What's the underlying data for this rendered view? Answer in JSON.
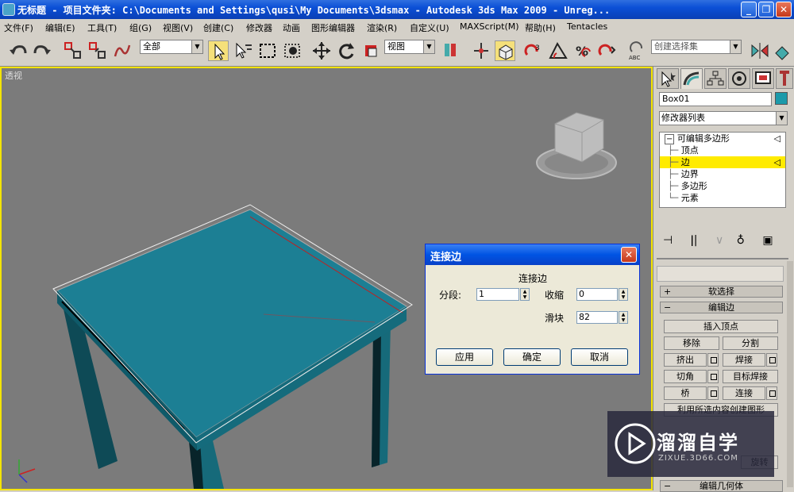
{
  "title": {
    "app_title": "无标题   - 项目文件夹: C:\\Documents and Settings\\qusi\\My Documents\\3dsmax   - Autodesk 3ds Max  2009  - Unreg..."
  },
  "menu": [
    "文件(F)",
    "编辑(E)",
    "工具(T)",
    "组(G)",
    "视图(V)",
    "创建(C)",
    "修改器",
    "动画",
    "图形编辑器",
    "渲染(R)",
    "自定义(U)",
    "MAXScript(M)",
    "帮助(H)",
    "Tentacles"
  ],
  "toolbar": {
    "selection_filter": "全部",
    "ref_coord": "视图",
    "named_selection": "创建选择集"
  },
  "viewport": {
    "label": "透视"
  },
  "dialog": {
    "title": "连接边",
    "group_label": "连接边",
    "segments_label": "分段:",
    "segments_value": "1",
    "pinch_label": "收缩",
    "pinch_value": "0",
    "slide_label": "滑块",
    "slide_value": "82",
    "apply": "应用",
    "ok": "确定",
    "cancel": "取消"
  },
  "panel": {
    "object_name": "Box01",
    "object_color": "#1c9aaa",
    "modifier_list": "修改器列表",
    "stack_root": "可编辑多边形",
    "stack_items": [
      "顶点",
      "边",
      "边界",
      "多边形",
      "元素"
    ],
    "selected_item": "边",
    "rollout_soft": "软选择",
    "rollout_edit_edges": "编辑边",
    "insert_vertex": "插入顶点",
    "remove": "移除",
    "split": "分割",
    "extrude": "挤出",
    "weld": "焊接",
    "chamfer": "切角",
    "target_weld": "目标焊接",
    "bridge": "桥",
    "connect": "连接",
    "create_shape": "利用所选内容创建图形",
    "rotate": "旋转",
    "rollout_edit_geometry": "编辑几何体"
  },
  "watermark": {
    "brand": "溜溜自学",
    "url": "ZIXUE.3D66.COM"
  },
  "colors": {
    "selection_highlight": "#ffeb00",
    "table_top": "#1c7f94"
  }
}
